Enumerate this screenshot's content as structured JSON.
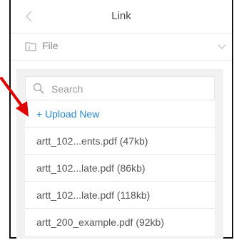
{
  "header": {
    "title": "Link",
    "back_icon": "chevron-left-icon"
  },
  "file_selector": {
    "label": "File",
    "icon": "folder-icon",
    "chevron_icon": "chevron-down-icon"
  },
  "search": {
    "placeholder": "Search",
    "icon": "search-icon"
  },
  "upload_label": "+ Upload New",
  "files": [
    "artt_102...ents.pdf (47kb)",
    "artt_102...late.pdf (86kb)",
    "artt_102...late.pdf (118kb)",
    "artt_200_example.pdf (92kb)"
  ],
  "colors": {
    "accent": "#2a86c9",
    "annotation_arrow": "#e10000",
    "panel": "#f2f2f2"
  }
}
